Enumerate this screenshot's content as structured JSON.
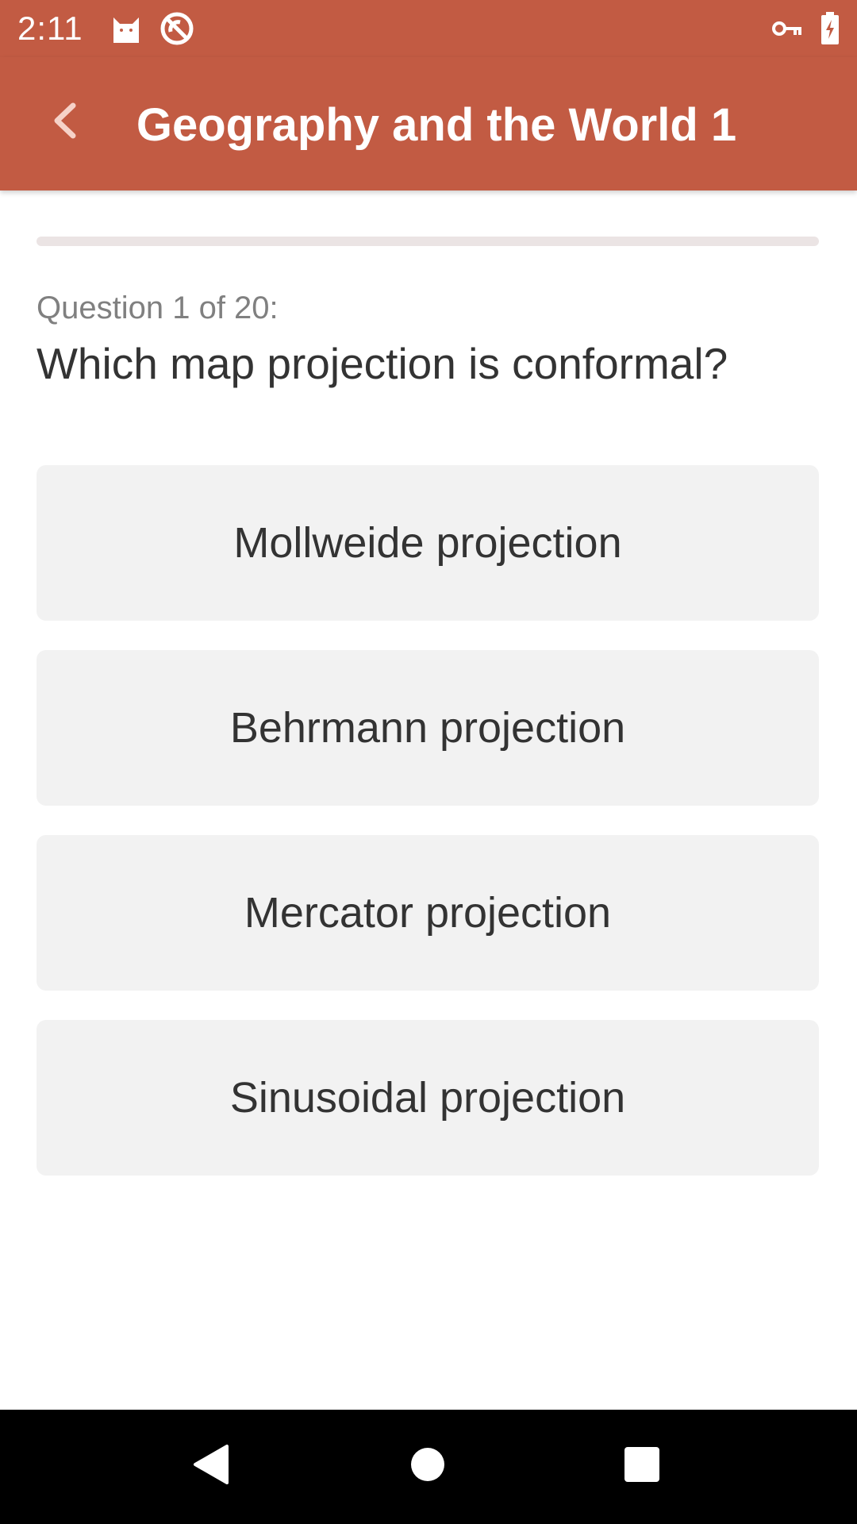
{
  "status_bar": {
    "time": "2:11",
    "icons": [
      "cat-notification-icon",
      "do-not-disturb-icon",
      "vpn-key-icon",
      "battery-charging-icon"
    ]
  },
  "app_bar": {
    "title": "Geography and the World 1",
    "back_icon": "chevron-left-icon",
    "color": "#c25b43"
  },
  "progress": {
    "fraction": 0.0
  },
  "question": {
    "counter": "Question 1 of 20:",
    "text": "Which map projection is conformal?"
  },
  "options": [
    {
      "label": "Mollweide projection"
    },
    {
      "label": "Behrmann projection"
    },
    {
      "label": "Mercator projection"
    },
    {
      "label": "Sinusoidal projection"
    }
  ],
  "nav_bar": {
    "icons": [
      "back-triangle-icon",
      "home-circle-icon",
      "recents-square-icon"
    ]
  }
}
